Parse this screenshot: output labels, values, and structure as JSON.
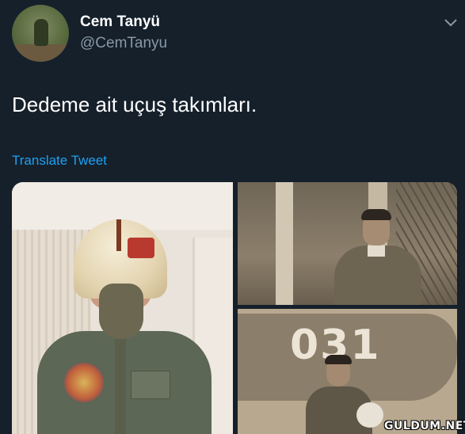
{
  "tweet": {
    "author_name": "Cem Tanyü",
    "author_handle": "@CemTanyu",
    "text": "Dedeme ait uçuş takımları.",
    "translate_label": "Translate Tweet",
    "more_icon": "chevron-down-icon"
  },
  "media": {
    "count": 3
  },
  "watermark": "GULDUM.NET",
  "colors": {
    "background": "#15202b",
    "link": "#1da1f2",
    "secondary_text": "#8899a6"
  }
}
